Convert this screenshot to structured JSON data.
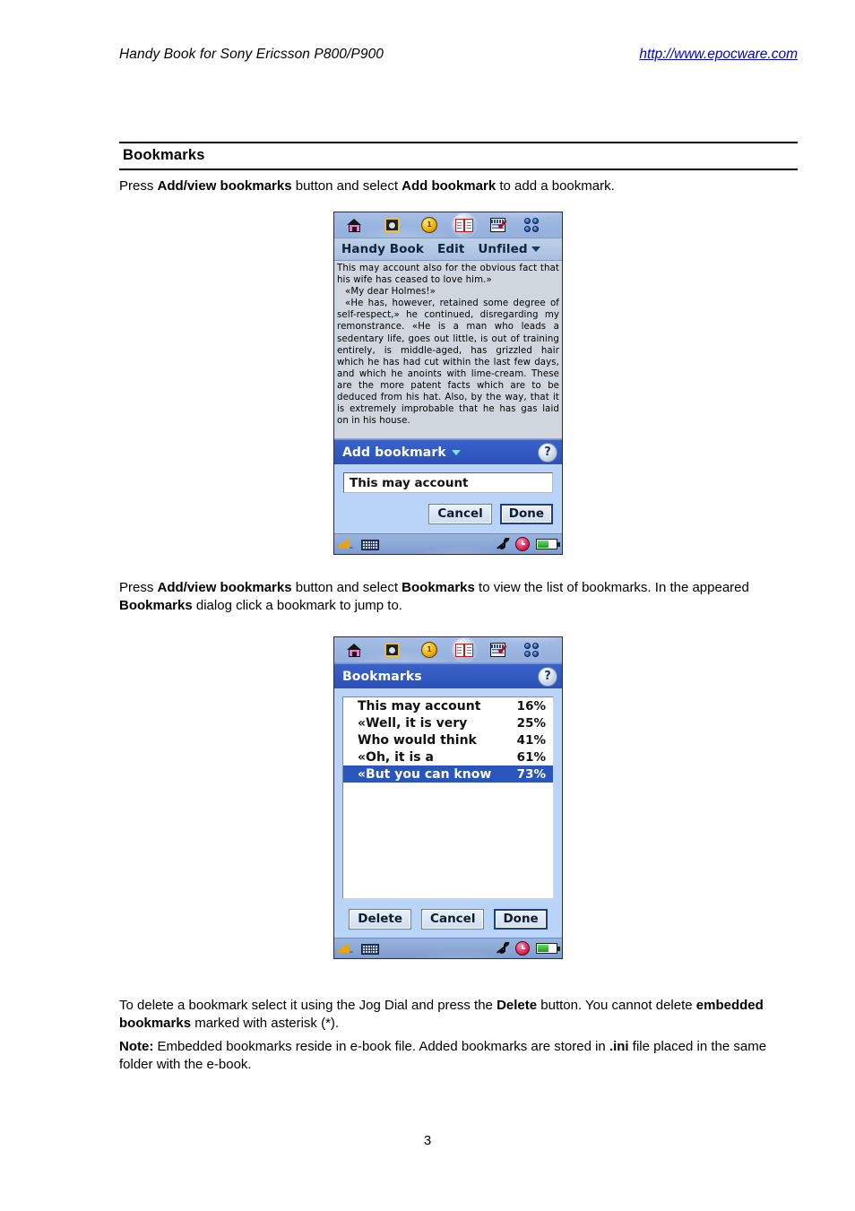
{
  "header": {
    "title": "Handy Book for Sony Ericsson P800/P900",
    "url": "http://www.epocware.com"
  },
  "section": {
    "heading": "Bookmarks"
  },
  "paragraphs": {
    "p1_a": "Press ",
    "p1_b1": "Add/view bookmarks",
    "p1_c": " button and select ",
    "p1_b2": "Add bookmark",
    "p1_d": " to add a bookmark.",
    "p2_a": "Press ",
    "p2_b1": "Add/view bookmarks",
    "p2_c": " button and select ",
    "p2_b2": "Bookmarks",
    "p2_d": " to view the list of bookmarks. In the appeared ",
    "p2_b3": "Bookmarks",
    "p2_e": " dialog click a bookmark to jump to.",
    "p3_a": "To delete a bookmark select it using the Jog Dial and press the ",
    "p3_b1": "Delete",
    "p3_c": " button. You cannot delete ",
    "p3_b2": "embedded bookmarks",
    "p3_d": " marked with asterisk (*).",
    "p4_b1": "Note:",
    "p4_a": " Embedded bookmarks reside in e-book file. Added bookmarks are stored in ",
    "p4_b2": ".ini",
    "p4_c": " file placed in the same folder with the e-book."
  },
  "page_number": "3",
  "screenshot1": {
    "toolbar_icons": [
      "home-icon",
      "safe-icon",
      "coin-icon",
      "open-book-icon",
      "checklist-icon",
      "grid-icon"
    ],
    "menubar": {
      "app": "Handy Book",
      "edit": "Edit",
      "folder": "Unfiled"
    },
    "reader_text": {
      "line1": "This may account also for the obvious fact that his wife has ceased to love him.»",
      "line2": "«My dear Holmes!»",
      "line3": "«He has, however, retained some degree of self-respect,» he continued, disregarding my remonstrance. «He is a man who leads a sedentary life, goes out little, is out of training entirely, is middle-aged, has grizzled hair which he has had cut within the last few days, and which he anoints with lime-cream. These are the more patent facts which are to be deduced from his hat. Also, by the way, that it is extremely improbable that he has gas laid on in his house."
    },
    "dialog": {
      "title": "Add bookmark",
      "help_label": "?",
      "field_value": "This may account",
      "cancel": "Cancel",
      "done": "Done"
    },
    "statusbar_icons": [
      "signal-icon",
      "keyboard-icon",
      "sound-muted-icon",
      "clock-icon",
      "battery-icon"
    ]
  },
  "screenshot2": {
    "toolbar_icons": [
      "home-icon",
      "safe-icon",
      "coin-icon",
      "open-book-icon",
      "checklist-icon",
      "grid-icon"
    ],
    "dialog": {
      "title": "Bookmarks",
      "help_label": "?"
    },
    "bookmarks": [
      {
        "label": "This may account",
        "percent": "16%",
        "selected": false
      },
      {
        "label": "«Well, it is very",
        "percent": "25%",
        "selected": false
      },
      {
        "label": "Who would think",
        "percent": "41%",
        "selected": false
      },
      {
        "label": "«Oh, it is a",
        "percent": "61%",
        "selected": false
      },
      {
        "label": "«But you can know",
        "percent": "73%",
        "selected": true
      }
    ],
    "buttons": {
      "delete": "Delete",
      "cancel": "Cancel",
      "done": "Done"
    },
    "statusbar_icons": [
      "signal-icon",
      "keyboard-icon",
      "sound-muted-icon",
      "clock-icon",
      "battery-icon"
    ]
  },
  "colors": {
    "link": "#0000d0",
    "dialog_title_bar": "#2b51b8",
    "selection": "#2a55bd",
    "dialog_body": "#b9d4f7",
    "reader_bg": "#cfd6de"
  }
}
